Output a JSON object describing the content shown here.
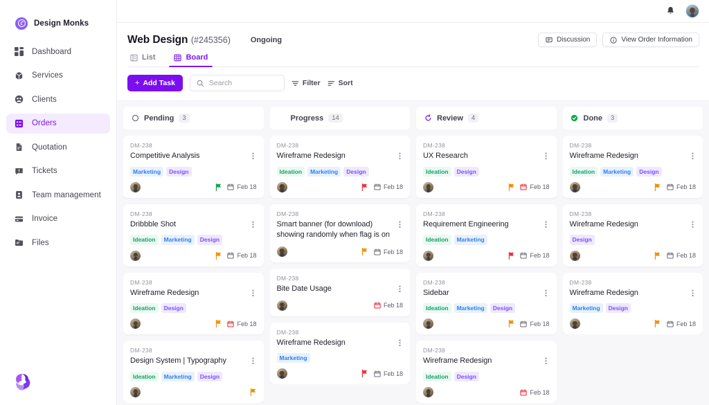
{
  "brand": {
    "name": "Design Monks",
    "mark_icon": "brand-circle-icon"
  },
  "sidebar": {
    "items": [
      {
        "label": "Dashboard",
        "icon": "grid-dashboard-icon",
        "active": false
      },
      {
        "label": "Services",
        "icon": "box-icon",
        "active": false
      },
      {
        "label": "Clients",
        "icon": "users-circle-icon",
        "active": false
      },
      {
        "label": "Orders",
        "icon": "orders-list-icon",
        "active": true
      },
      {
        "label": "Quotation",
        "icon": "document-icon",
        "active": false
      },
      {
        "label": "Tickets",
        "icon": "ticket-chat-icon",
        "active": false
      },
      {
        "label": "Team management",
        "icon": "id-badge-icon",
        "active": false
      },
      {
        "label": "Invoice",
        "icon": "card-icon",
        "active": false
      },
      {
        "label": "Files",
        "icon": "folder-icon",
        "active": false
      }
    ],
    "footer_logo_icon": "trilobe-logo-icon"
  },
  "topbar": {
    "notification_icon": "bell-icon",
    "avatar_icon": "user-avatar"
  },
  "header": {
    "project_title": "Web Design",
    "project_id": "(#245356)",
    "status": "Ongoing",
    "status_icon": "half-moon-icon",
    "status_color": "#f0b429",
    "actions": [
      {
        "label": "Discussion",
        "icon": "comment-icon"
      },
      {
        "label": "View Order Information",
        "icon": "info-circle-icon"
      }
    ]
  },
  "tabs": [
    {
      "label": "List",
      "icon": "list-view-icon",
      "active": false
    },
    {
      "label": "Board",
      "icon": "board-view-icon",
      "active": true
    }
  ],
  "toolbar": {
    "add_task_label": "Add Task",
    "add_task_plus": "+",
    "search_placeholder": "Search",
    "search_value": "",
    "search_icon": "search-icon",
    "filter_label": "Filter",
    "filter_icon": "filter-icon",
    "sort_label": "Sort",
    "sort_icon": "sort-icon"
  },
  "accents": {
    "primary": "#7a0ef0",
    "primary_soft": "#f4ebff",
    "board_bg": "#f7f7fa",
    "ideation": "#17a06a",
    "marketing": "#2f80ed",
    "design": "#7c4dff",
    "flag_red": "#e8343c",
    "flag_orange": "#f29100",
    "flag_green": "#16a34a",
    "cal_red": "#e8343c",
    "cal_gray": "#6b6c78",
    "done_green": "#16a34a",
    "review_purple": "#6d28d9"
  },
  "columns": [
    {
      "id": "pending",
      "title": "Pending",
      "count": "3",
      "icon": "circle-outline-icon",
      "icon_color": "#6b6c78",
      "cards": [
        {
          "id": "DM-238",
          "title": "Competitive Analysis",
          "tags": [
            "Marketing",
            "Design"
          ],
          "flag": "green",
          "due": "Feb 18",
          "cal": "gray"
        },
        {
          "id": "DM-238",
          "title": "Dribbble Shot",
          "tags": [
            "Ideation",
            "Marketing",
            "Design"
          ],
          "flag": "orange",
          "due": "Feb 18",
          "cal": "gray"
        },
        {
          "id": "DM-238",
          "title": "Wireframe Redesign",
          "tags": [
            "Ideation",
            "Design"
          ],
          "flag": "orange",
          "due": "Feb 18",
          "cal": "red"
        },
        {
          "id": "DM-238",
          "title": "Design System | Typography",
          "tags": [
            "Ideation",
            "Marketing",
            "Design"
          ],
          "flag": "orange",
          "due": "",
          "cal": "none"
        }
      ]
    },
    {
      "id": "progress",
      "title": "Progress",
      "count": "14",
      "icon": "half-moon-icon",
      "icon_color": "#f0b429",
      "cards": [
        {
          "id": "DM-238",
          "title": "Wireframe Redesign",
          "tags": [
            "Ideation",
            "Marketing",
            "Design"
          ],
          "flag": "red",
          "due": "Feb 18",
          "cal": "gray"
        },
        {
          "id": "DM-238",
          "title": "Smart banner (for download) showing randomly when flag is on",
          "tags": [],
          "flag": "orange",
          "due": "Feb 18",
          "cal": "gray"
        },
        {
          "id": "DM-238",
          "title": "Bite Date Usage",
          "tags": [],
          "flag": "none",
          "due": "Feb 18",
          "cal": "red"
        },
        {
          "id": "DM-238",
          "title": "Wireframe Redesign",
          "tags": [
            "Marketing"
          ],
          "flag": "red",
          "due": "Feb 18",
          "cal": "gray"
        }
      ]
    },
    {
      "id": "review",
      "title": "Review",
      "count": "4",
      "icon": "refresh-review-icon",
      "icon_color": "#6d28d9",
      "cards": [
        {
          "id": "DM-238",
          "title": "UX Research",
          "tags": [
            "Ideation",
            "Design"
          ],
          "flag": "orange",
          "due": "Feb 18",
          "cal": "red"
        },
        {
          "id": "DM-238",
          "title": "Requirement Engineering",
          "tags": [
            "Ideation",
            "Marketing"
          ],
          "flag": "red",
          "due": "Feb 18",
          "cal": "gray"
        },
        {
          "id": "DM-238",
          "title": "Sidebar",
          "tags": [
            "Ideation",
            "Marketing",
            "Design"
          ],
          "flag": "orange",
          "due": "Feb 18",
          "cal": "gray"
        },
        {
          "id": "DM-238",
          "title": "Wireframe Redesign",
          "tags": [
            "Ideation",
            "Design"
          ],
          "flag": "none",
          "due": "Feb 18",
          "cal": "red"
        }
      ]
    },
    {
      "id": "done",
      "title": "Done",
      "count": "3",
      "icon": "check-circle-icon",
      "icon_color": "#16a34a",
      "cards": [
        {
          "id": "DM-238",
          "title": "Wireframe Redesign",
          "tags": [
            "Ideation",
            "Marketing",
            "Design"
          ],
          "flag": "orange",
          "due": "Feb 18",
          "cal": "gray"
        },
        {
          "id": "DM-238",
          "title": "Wireframe Redesign",
          "tags": [
            "Design"
          ],
          "flag": "orange",
          "due": "Feb 18",
          "cal": "gray"
        },
        {
          "id": "DM-238",
          "title": "Wireframe Redesign",
          "tags": [
            "Marketing",
            "Design"
          ],
          "flag": "orange",
          "due": "Feb 18",
          "cal": "gray"
        }
      ]
    }
  ]
}
